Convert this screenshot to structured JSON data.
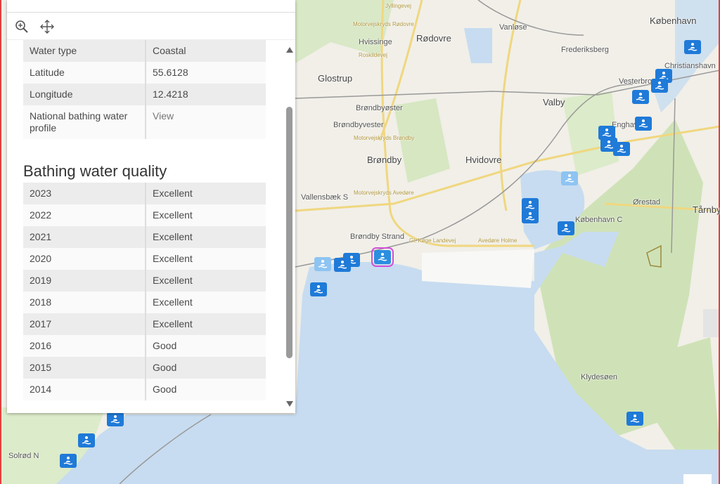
{
  "toolbar": {
    "zoom_icon": "zoom-in-icon",
    "pan_icon": "move-icon"
  },
  "attributes": [
    {
      "label": "Water type",
      "value": "Coastal"
    },
    {
      "label": "Latitude",
      "value": "55.6128"
    },
    {
      "label": "Longitude",
      "value": "12.4218"
    },
    {
      "label": "National bathing water profile",
      "value": "View"
    }
  ],
  "quality": {
    "title": "Bathing water quality",
    "rows": [
      {
        "year": "2023",
        "rating": "Excellent"
      },
      {
        "year": "2022",
        "rating": "Excellent"
      },
      {
        "year": "2021",
        "rating": "Excellent"
      },
      {
        "year": "2020",
        "rating": "Excellent"
      },
      {
        "year": "2019",
        "rating": "Excellent"
      },
      {
        "year": "2018",
        "rating": "Excellent"
      },
      {
        "year": "2017",
        "rating": "Excellent"
      },
      {
        "year": "2016",
        "rating": "Good"
      },
      {
        "year": "2015",
        "rating": "Good"
      },
      {
        "year": "2014",
        "rating": "Good"
      }
    ]
  },
  "map": {
    "places": [
      "København",
      "Rødovre",
      "Vanløse",
      "Hvissinge",
      "Frederiksberg",
      "Christianshavn",
      "Glostrup",
      "Vesterbro",
      "Brøndbyøster",
      "Valby",
      "Brøndbyvester",
      "Enghave",
      "Brøndby",
      "Hvidovre",
      "Brøndby Strand",
      "Tårnby",
      "Klydesøen",
      "Solrød N",
      "Ørestad",
      "Vallensbæk S",
      "København C"
    ],
    "roads": [
      "Jyllingevej",
      "Motorvejskryds Rødovre",
      "Roskildevej",
      "Motorvejskryds Brøndby",
      "Motorvejskryds Avedøre",
      "Gl. Køge Landevej",
      "Avedøre Holme"
    ],
    "marker_icon": "swimmer-icon",
    "colors": {
      "marker": "#1f7ad8",
      "marker_inactive": "#8ec4f2",
      "selected_outline": "#d24fd8",
      "water": "#c7dcf0"
    }
  }
}
